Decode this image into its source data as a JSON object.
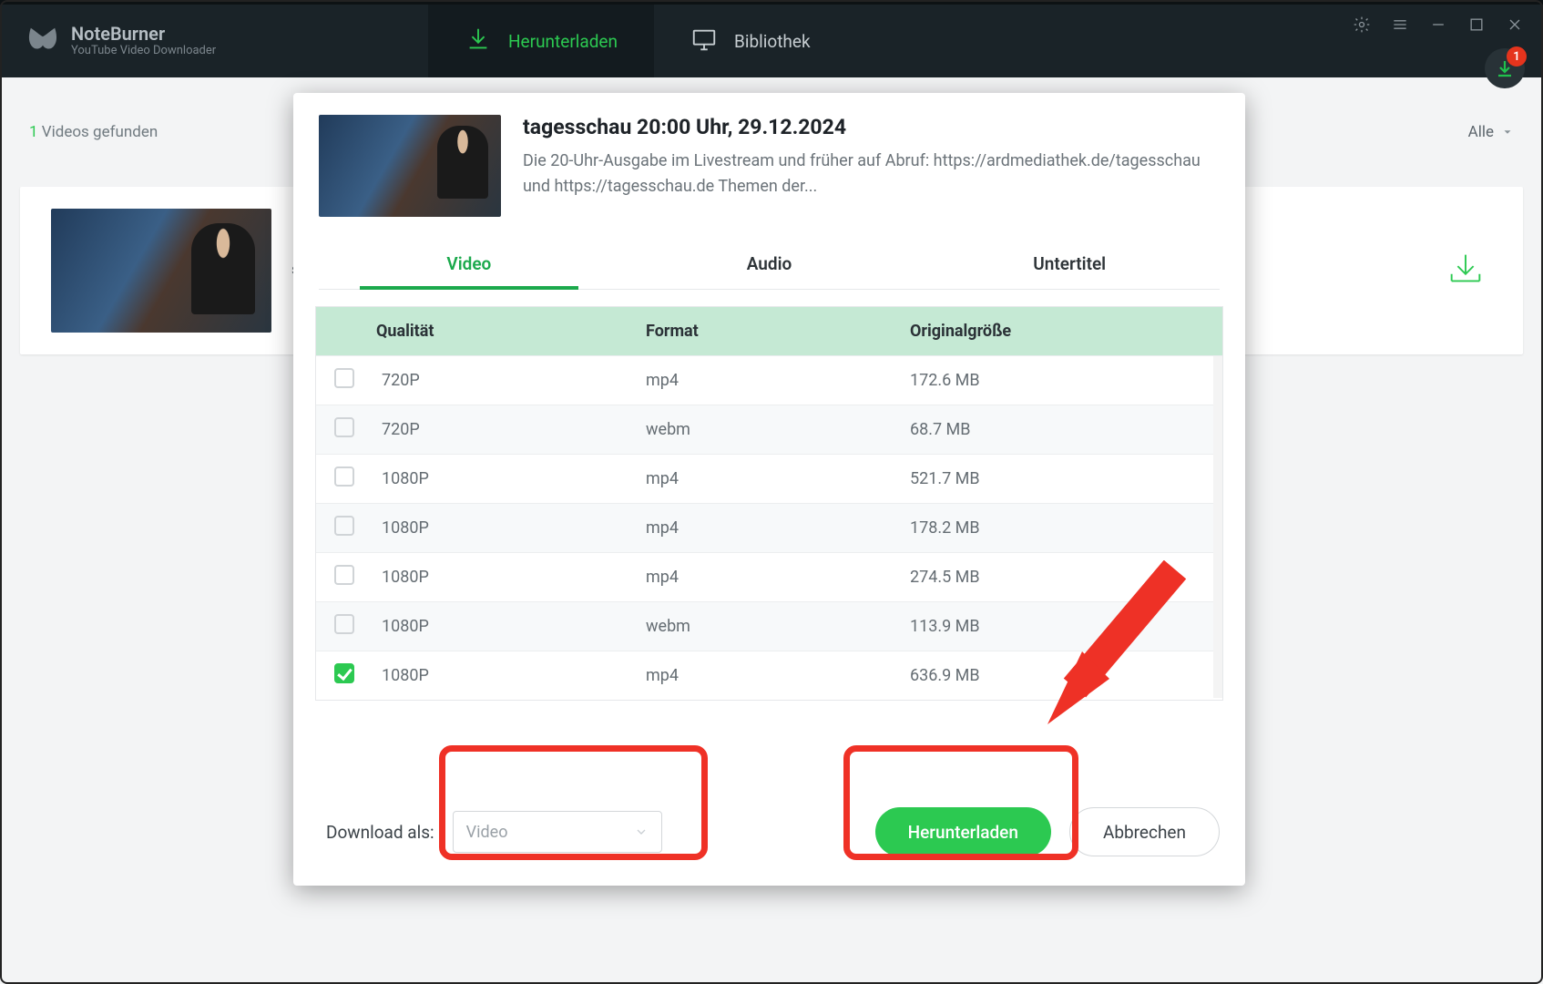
{
  "app": {
    "name": "NoteBurner",
    "subtitle": "YouTube Video Downloader"
  },
  "nav": {
    "download": "Herunterladen",
    "library": "Bibliothek"
  },
  "download_badge": {
    "count": "1"
  },
  "results": {
    "count": "1",
    "suffix": "Videos gefunden",
    "filter_label": "Alle"
  },
  "card_body": "schau.de  .",
  "modal": {
    "title": "tagesschau 20:00 Uhr, 29.12.2024",
    "desc": "Die 20-Uhr-Ausgabe im Livestream und früher auf Abruf: https://ardmediathek.de/tagesschau und https://tagesschau.de Themen der...",
    "tabs": {
      "video": "Video",
      "audio": "Audio",
      "subs": "Untertitel"
    },
    "cols": {
      "quality": "Qualität",
      "format": "Format",
      "size": "Originalgröße"
    },
    "rows": [
      {
        "checked": false,
        "quality": "720P",
        "format": "mp4",
        "size": "172.6 MB"
      },
      {
        "checked": false,
        "quality": "720P",
        "format": "webm",
        "size": "68.7 MB"
      },
      {
        "checked": false,
        "quality": "1080P",
        "format": "mp4",
        "size": "521.7 MB"
      },
      {
        "checked": false,
        "quality": "1080P",
        "format": "mp4",
        "size": "178.2 MB"
      },
      {
        "checked": false,
        "quality": "1080P",
        "format": "mp4",
        "size": "274.5 MB"
      },
      {
        "checked": false,
        "quality": "1080P",
        "format": "webm",
        "size": "113.9 MB"
      },
      {
        "checked": true,
        "quality": "1080P",
        "format": "mp4",
        "size": "636.9 MB"
      }
    ],
    "download_as_label": "Download als:",
    "download_as_value": "Video",
    "btn_download": "Herunterladen",
    "btn_cancel": "Abbrechen"
  }
}
